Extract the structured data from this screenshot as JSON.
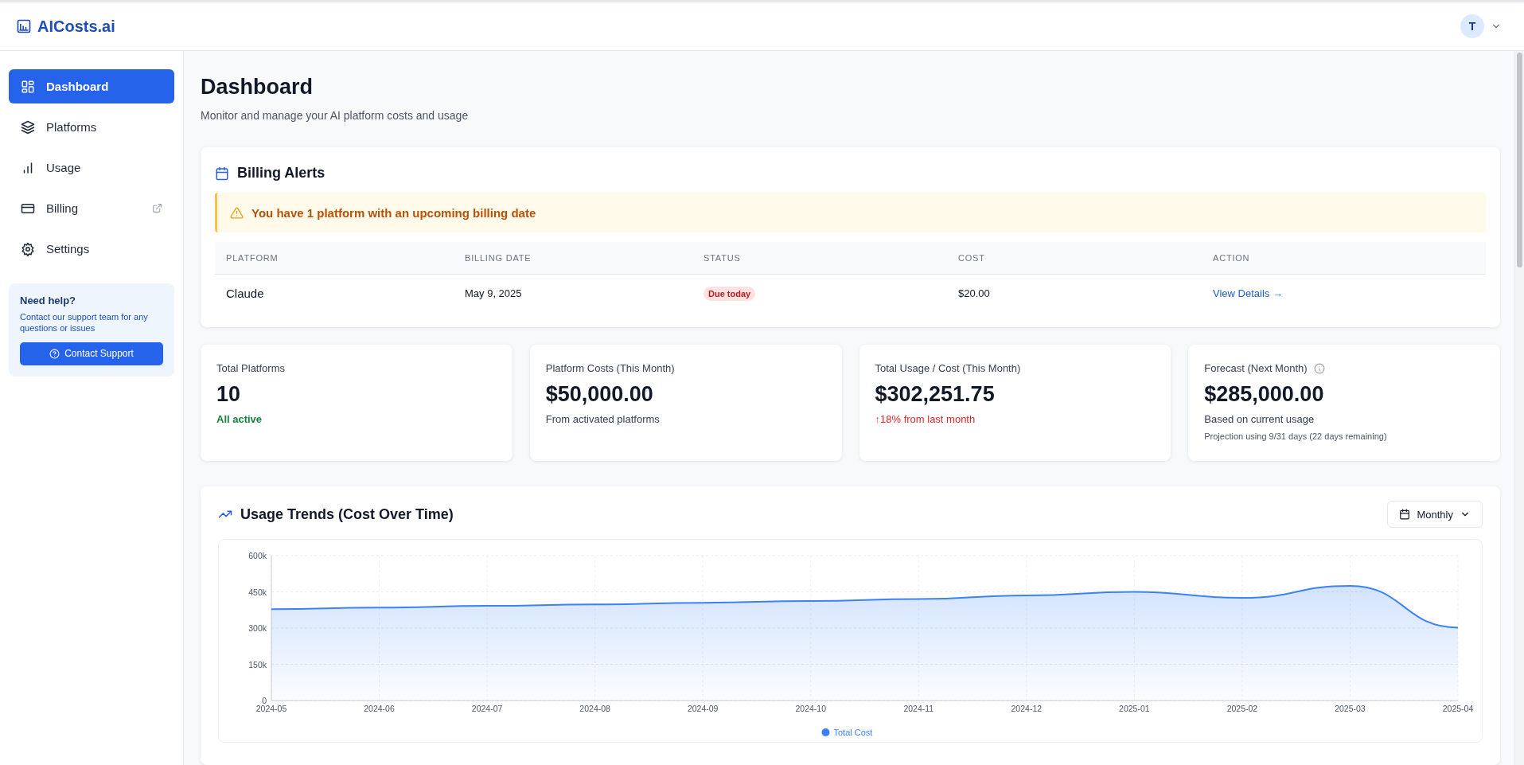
{
  "header": {
    "logo": "AICosts.ai",
    "avatar_initial": "T"
  },
  "sidebar": {
    "items": [
      {
        "label": "Dashboard",
        "kind": "grid",
        "selected": true,
        "external": false
      },
      {
        "label": "Platforms",
        "kind": "layers",
        "selected": false,
        "external": false
      },
      {
        "label": "Usage",
        "kind": "bars",
        "selected": false,
        "external": false
      },
      {
        "label": "Billing",
        "kind": "card",
        "selected": false,
        "external": true
      },
      {
        "label": "Settings",
        "kind": "gear",
        "selected": false,
        "external": false
      }
    ],
    "help": {
      "title": "Need help?",
      "text": "Contact our support team for any questions or issues",
      "button": "Contact Support"
    }
  },
  "page": {
    "title": "Dashboard",
    "subtitle": "Monitor and manage your AI platform costs and usage"
  },
  "billing_alerts": {
    "title": "Billing Alerts",
    "alert": "You have 1 platform with an upcoming billing date",
    "table": {
      "columns": [
        "PLATFORM",
        "BILLING DATE",
        "STATUS",
        "COST",
        "ACTION"
      ],
      "rows": [
        {
          "platform": "Claude",
          "billing_date": "May 9, 2025",
          "status": "Due today",
          "cost": "$20.00",
          "action": "View Details →"
        }
      ]
    }
  },
  "stats": [
    {
      "label": "Total Platforms",
      "value": "10",
      "note": "All active",
      "color": "#15803d",
      "info": false
    },
    {
      "label": "Platform Costs (This Month)",
      "value": "$50,000.00",
      "note": "From activated platforms",
      "color": "#374151",
      "info": false
    },
    {
      "label": "Total Usage / Cost (This Month)",
      "value": "$302,251.75",
      "note": "↑18% from last month",
      "color": "#dc2626",
      "info": false
    },
    {
      "label": "Forecast (Next Month)",
      "value": "$285,000.00",
      "note": "Based on current usage",
      "color": "#374151",
      "info": true,
      "detail": "Projection using 9/31 days (22 days remaining)"
    }
  ],
  "usage_trends": {
    "title": "Usage Trends (Cost Over Time)",
    "period": "Monthly",
    "chart_data": {
      "type": "area",
      "categories": [
        "2024-05",
        "2024-06",
        "2024-07",
        "2024-08",
        "2024-09",
        "2024-10",
        "2024-11",
        "2024-12",
        "2025-01",
        "2025-02",
        "2025-03",
        "2025-04"
      ],
      "series": [
        {
          "name": "Total Cost",
          "color": "#3b82f6",
          "values": [
            378000,
            385000,
            392000,
            398000,
            405000,
            412000,
            420000,
            435000,
            450000,
            425000,
            475000,
            302000
          ]
        }
      ],
      "ylim": [
        0,
        600000
      ],
      "grid": true,
      "yticks": [
        {
          "value": 0,
          "label": "0"
        },
        {
          "value": 150000,
          "label": "150k"
        },
        {
          "value": 300000,
          "label": "300k"
        },
        {
          "value": 450000,
          "label": "450k"
        },
        {
          "value": 600000,
          "label": "600k"
        }
      ]
    }
  }
}
